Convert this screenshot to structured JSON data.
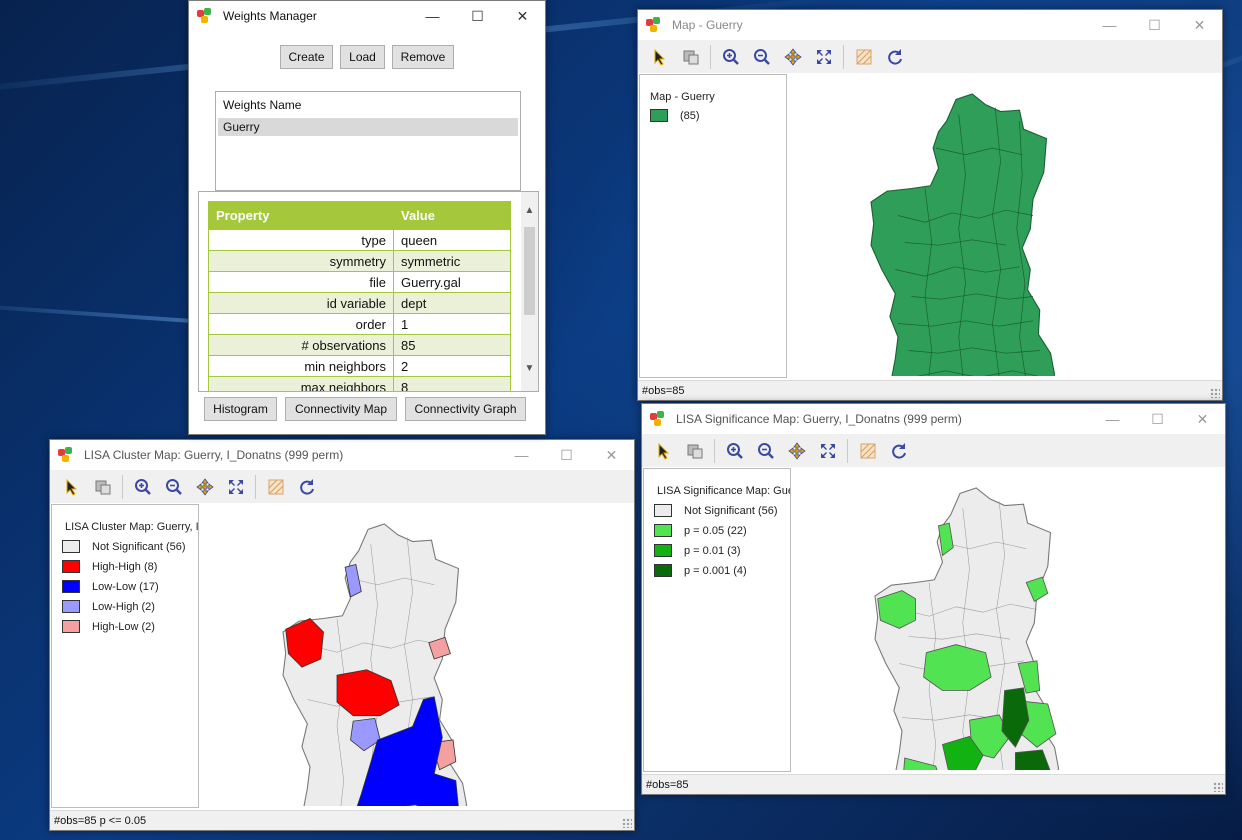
{
  "colors": {
    "guerry_green": "#2e9e58",
    "not_significant": "#ececec",
    "high_high": "#ff0000",
    "low_low": "#0000ff",
    "low_high": "#9999ff",
    "high_low": "#f4a0a0",
    "p05": "#52e352",
    "p01": "#12b212",
    "p001": "#0a6a0a",
    "table_header": "#a5c73a"
  },
  "weights_manager": {
    "title": "Weights Manager",
    "buttons": {
      "create": "Create",
      "load": "Load",
      "remove": "Remove"
    },
    "list_header": "Weights Name",
    "list_items": [
      "Guerry"
    ],
    "table": {
      "headers": [
        "Property",
        "Value"
      ],
      "rows": [
        {
          "property": "type",
          "value": "queen"
        },
        {
          "property": "symmetry",
          "value": "symmetric"
        },
        {
          "property": "file",
          "value": "Guerry.gal"
        },
        {
          "property": "id variable",
          "value": "dept"
        },
        {
          "property": "order",
          "value": "1"
        },
        {
          "property": "# observations",
          "value": "85"
        },
        {
          "property": "min neighbors",
          "value": "2"
        },
        {
          "property": "max neighbors",
          "value": "8"
        }
      ]
    },
    "bottom_buttons": {
      "histogram": "Histogram",
      "connectivity_map": "Connectivity Map",
      "connectivity_graph": "Connectivity Graph"
    }
  },
  "map_guerry": {
    "title": "Map - Guerry",
    "legend_title": "Map - Guerry",
    "legend_items": [
      {
        "label": "(85)",
        "color": "#2e9e58"
      }
    ],
    "status": "#obs=85"
  },
  "lisa_cluster": {
    "title": "LISA Cluster Map: Guerry, I_Donatns (999 perm)",
    "legend_title": "LISA Cluster Map: Guerry, I_",
    "legend_items": [
      {
        "label": "Not Significant (56)",
        "color": "#ececec"
      },
      {
        "label": "High-High (8)",
        "color": "#ff0000"
      },
      {
        "label": "Low-Low (17)",
        "color": "#0000ff"
      },
      {
        "label": "Low-High (2)",
        "color": "#9999ff"
      },
      {
        "label": "High-Low (2)",
        "color": "#f4a0a0"
      }
    ],
    "status": "#obs=85  p <= 0.05"
  },
  "lisa_significance": {
    "title": "LISA Significance Map: Guerry, I_Donatns (999 perm)",
    "legend_title": "LISA Significance Map: Gue",
    "legend_items": [
      {
        "label": "Not Significant (56)",
        "color": "#ececec"
      },
      {
        "label": "p = 0.05 (22)",
        "color": "#52e352"
      },
      {
        "label": "p = 0.01 (3)",
        "color": "#12b212"
      },
      {
        "label": "p = 0.001 (4)",
        "color": "#0a6a0a"
      }
    ],
    "status": "#obs=85"
  }
}
